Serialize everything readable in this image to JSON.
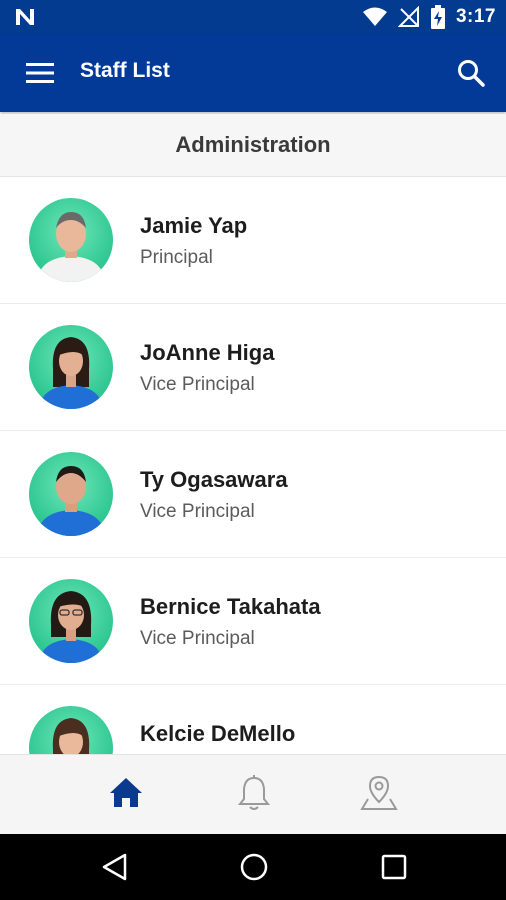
{
  "status_bar": {
    "time": "3:17"
  },
  "app_bar": {
    "title": "Staff List"
  },
  "section": {
    "title": "Administration"
  },
  "staff": [
    {
      "name": "Jamie Yap",
      "role": "Principal"
    },
    {
      "name": "JoAnne Higa",
      "role": "Vice Principal"
    },
    {
      "name": "Ty Ogasawara",
      "role": "Vice Principal"
    },
    {
      "name": "Bernice Takahata",
      "role": "Vice Principal"
    },
    {
      "name": "Kelcie DeMello",
      "role": ""
    }
  ],
  "colors": {
    "primary": "#043a97",
    "status_bar": "#023b8f",
    "avatar_bg": "#2ec692",
    "nav_active": "#0a3a8f",
    "nav_inactive": "#9a9a9a"
  },
  "icons": {
    "app_bar": [
      "menu-icon",
      "search-icon"
    ],
    "bottom_nav": [
      "home-icon",
      "bell-icon",
      "map-pin-icon"
    ],
    "system_nav": [
      "back-icon",
      "home-circle-icon",
      "recents-icon"
    ]
  }
}
